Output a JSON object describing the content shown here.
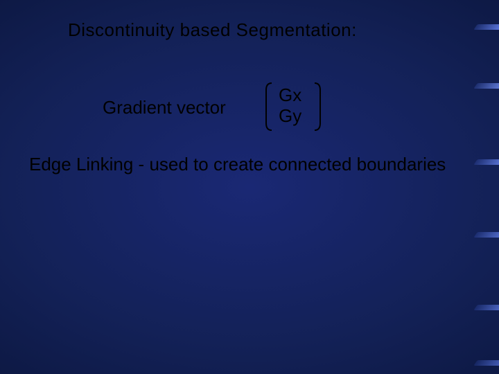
{
  "title": "Discontinuity based Segmentation:",
  "gradient_label": "Gradient vector",
  "vector": {
    "gx": "Gx",
    "gy": "Gy"
  },
  "edge_linking": "Edge Linking - used to create connected boundaries"
}
